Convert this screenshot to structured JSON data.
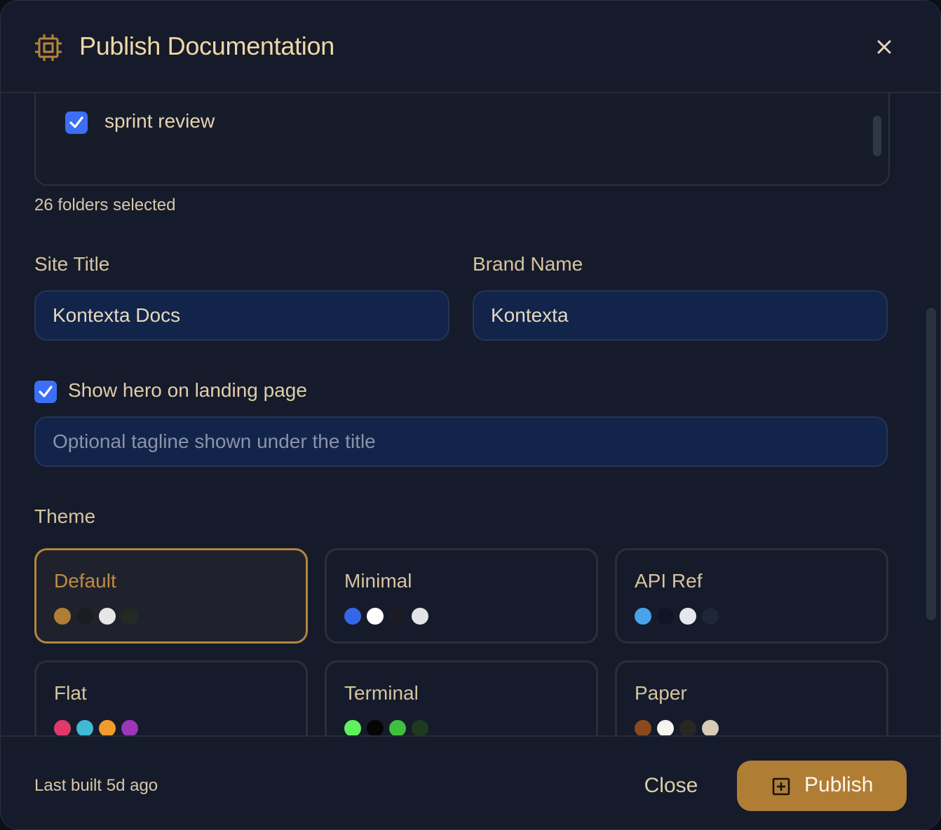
{
  "dialog": {
    "title": "Publish Documentation",
    "icon": "chip-icon",
    "close_icon": "close-icon"
  },
  "folders": {
    "items": [
      {
        "label": "sprint review",
        "checked": true
      }
    ],
    "count_text": "26 folders selected"
  },
  "form": {
    "site_title_label": "Site Title",
    "site_title_value": "Kontexta Docs",
    "brand_name_label": "Brand Name",
    "brand_name_value": "Kontexta",
    "hero_checkbox_label": "Show hero on landing page",
    "hero_checked": true,
    "tagline_placeholder": "Optional tagline shown under the title",
    "tagline_value": ""
  },
  "themes": {
    "label": "Theme",
    "selected": "Default",
    "items": [
      {
        "name": "Default",
        "colors": [
          "#b07d35",
          "#1b1d22",
          "#e6e6e6",
          "#222a22"
        ]
      },
      {
        "name": "Minimal",
        "colors": [
          "#3566e8",
          "#ffffff",
          "#1a1c22",
          "#e4e4e6"
        ]
      },
      {
        "name": "API Ref",
        "colors": [
          "#4aa3e8",
          "#0f1524",
          "#e4e8ee",
          "#1e2638"
        ]
      },
      {
        "name": "Flat",
        "colors": [
          "#e03a6a",
          "#42b8d6",
          "#f39a2c",
          "#9b36b8"
        ]
      },
      {
        "name": "Terminal",
        "colors": [
          "#5ef25e",
          "#050505",
          "#3fbf3f",
          "#1f3a1f"
        ]
      },
      {
        "name": "Paper",
        "colors": [
          "#8b4a1e",
          "#f6f4f0",
          "#2a2622",
          "#d6cbb8"
        ]
      }
    ]
  },
  "footer": {
    "last_built": "Last built 5d ago",
    "close_label": "Close",
    "publish_label": "Publish",
    "publish_icon": "plus-square-icon"
  },
  "colors": {
    "accent": "#b07d35",
    "checkbox": "#3b6ff5",
    "input_bg": "#12244a"
  }
}
